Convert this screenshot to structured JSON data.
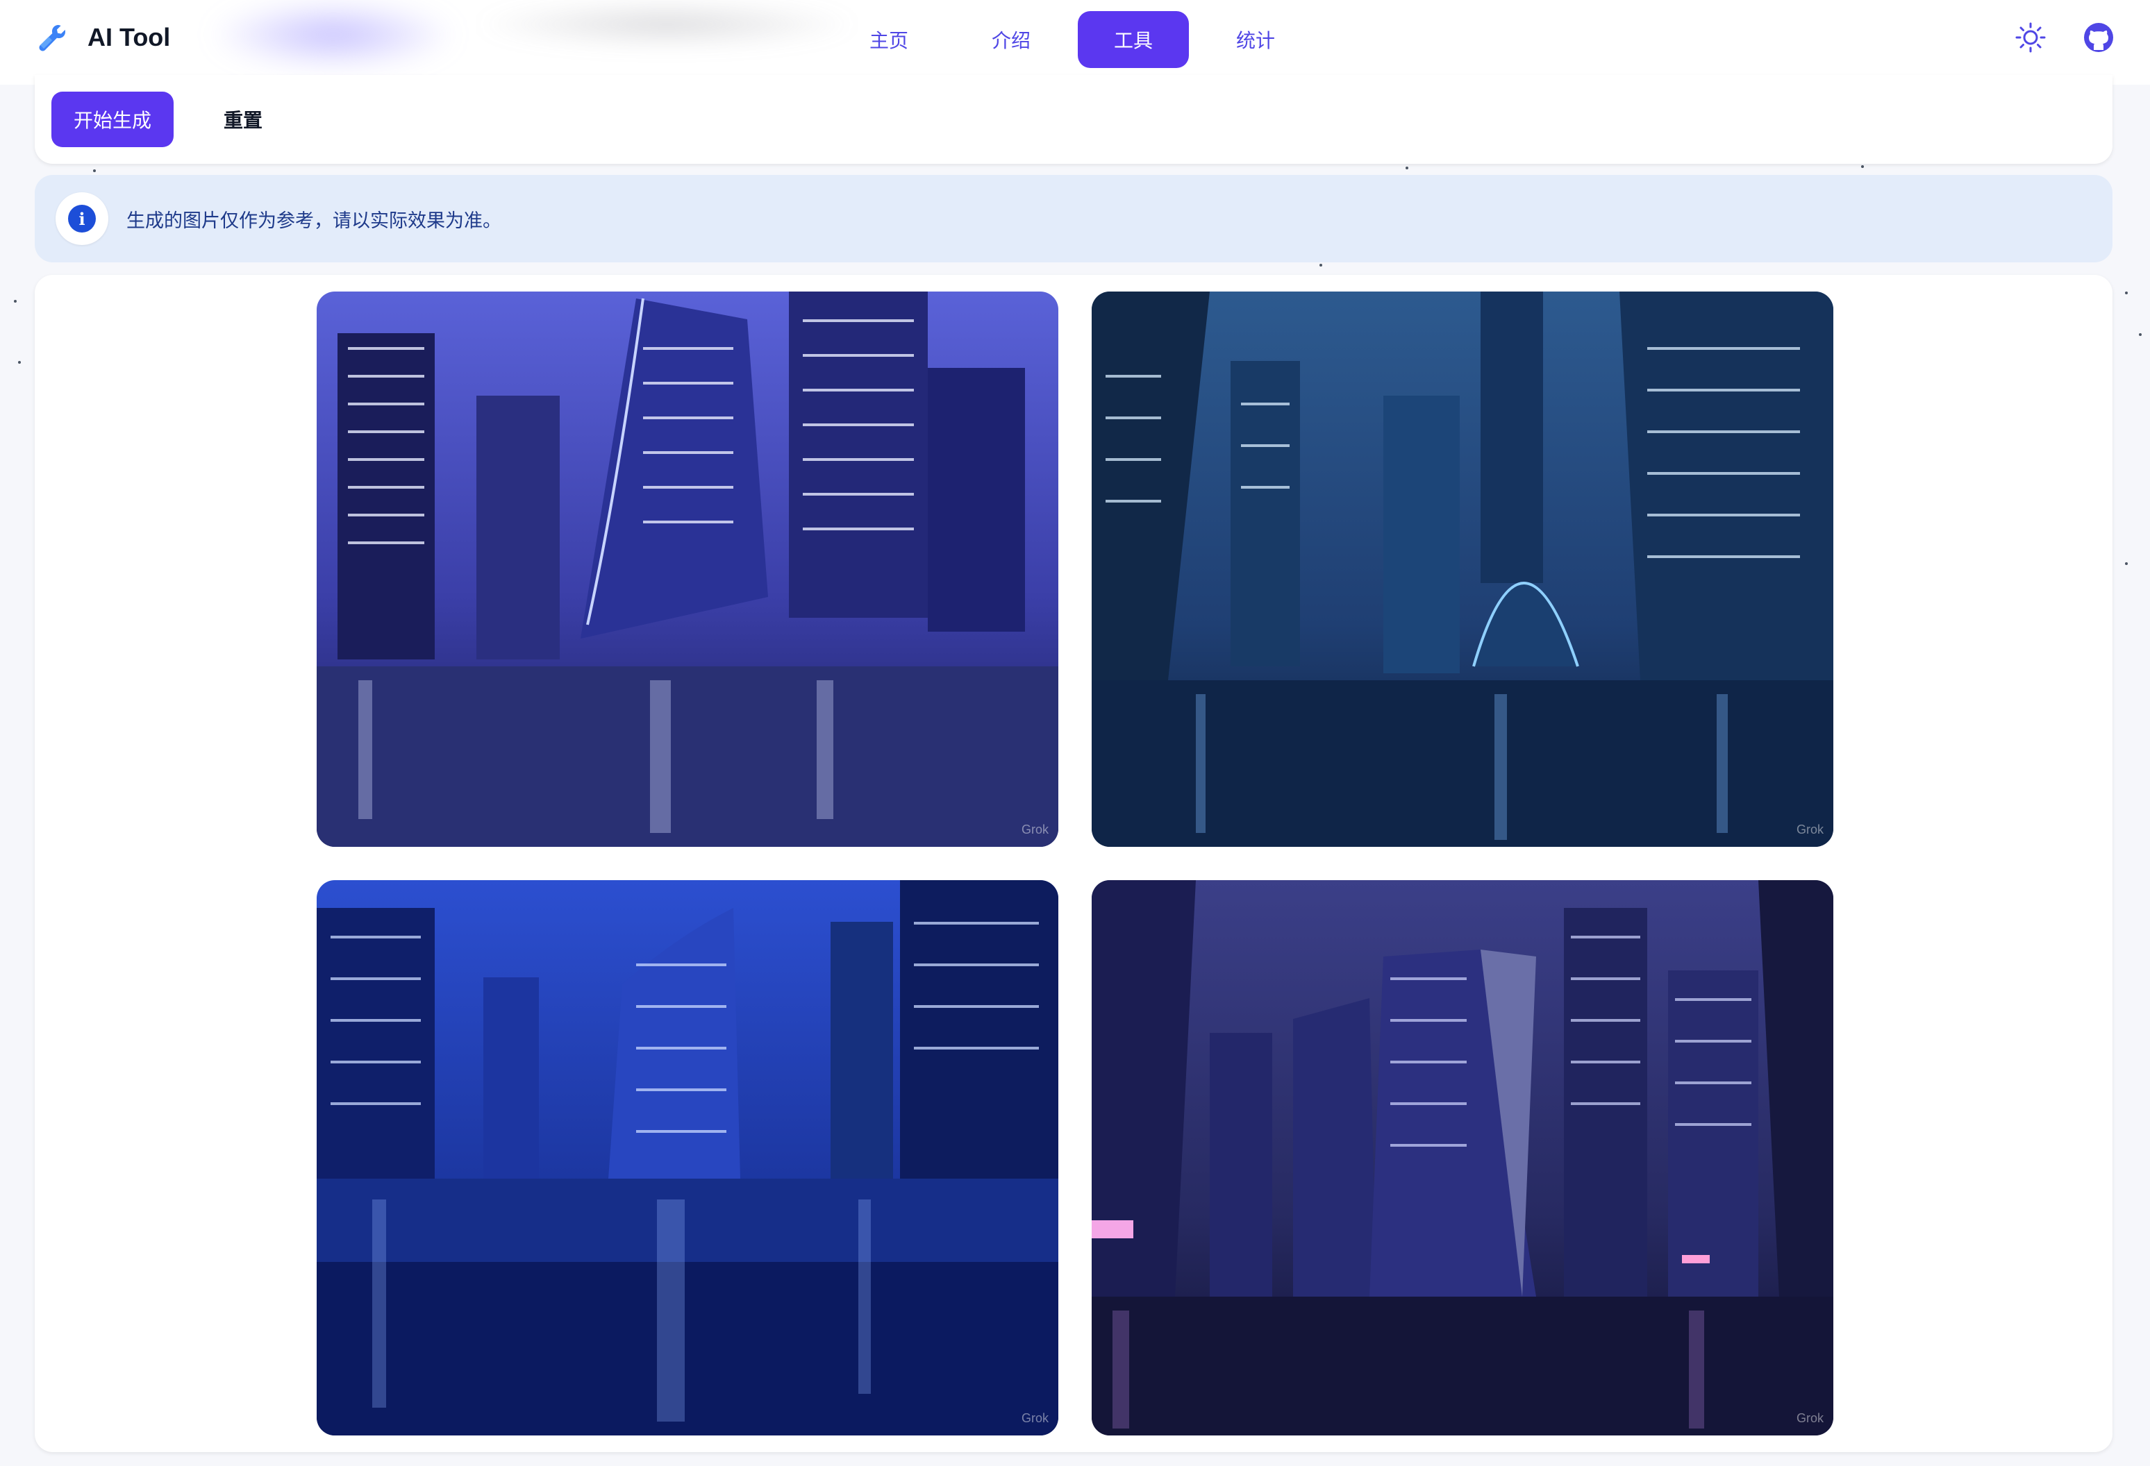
{
  "app": {
    "title": "AI Tool"
  },
  "nav": {
    "items": [
      {
        "label": "主页",
        "active": false
      },
      {
        "label": "介绍",
        "active": false
      },
      {
        "label": "工具",
        "active": true
      },
      {
        "label": "统计",
        "active": false
      }
    ]
  },
  "header_icons": [
    "sun-icon",
    "github-icon"
  ],
  "toolbar": {
    "start_label": "开始生成",
    "reset_label": "重置"
  },
  "alert": {
    "icon": "info-icon",
    "text": "生成的图片仅作为参考，请以实际效果为准。"
  },
  "gallery": {
    "images": [
      {
        "watermark": "Grok",
        "scene": "night-city-rain-violet"
      },
      {
        "watermark": "Grok",
        "scene": "night-city-rain-teal"
      },
      {
        "watermark": "Grok",
        "scene": "night-city-rain-blue"
      },
      {
        "watermark": "Grok",
        "scene": "night-city-rain-indigo"
      }
    ]
  },
  "colors": {
    "accent": "#5b37f0",
    "alert_bg": "#e3ecfa",
    "alert_text": "#1e3a8a"
  }
}
